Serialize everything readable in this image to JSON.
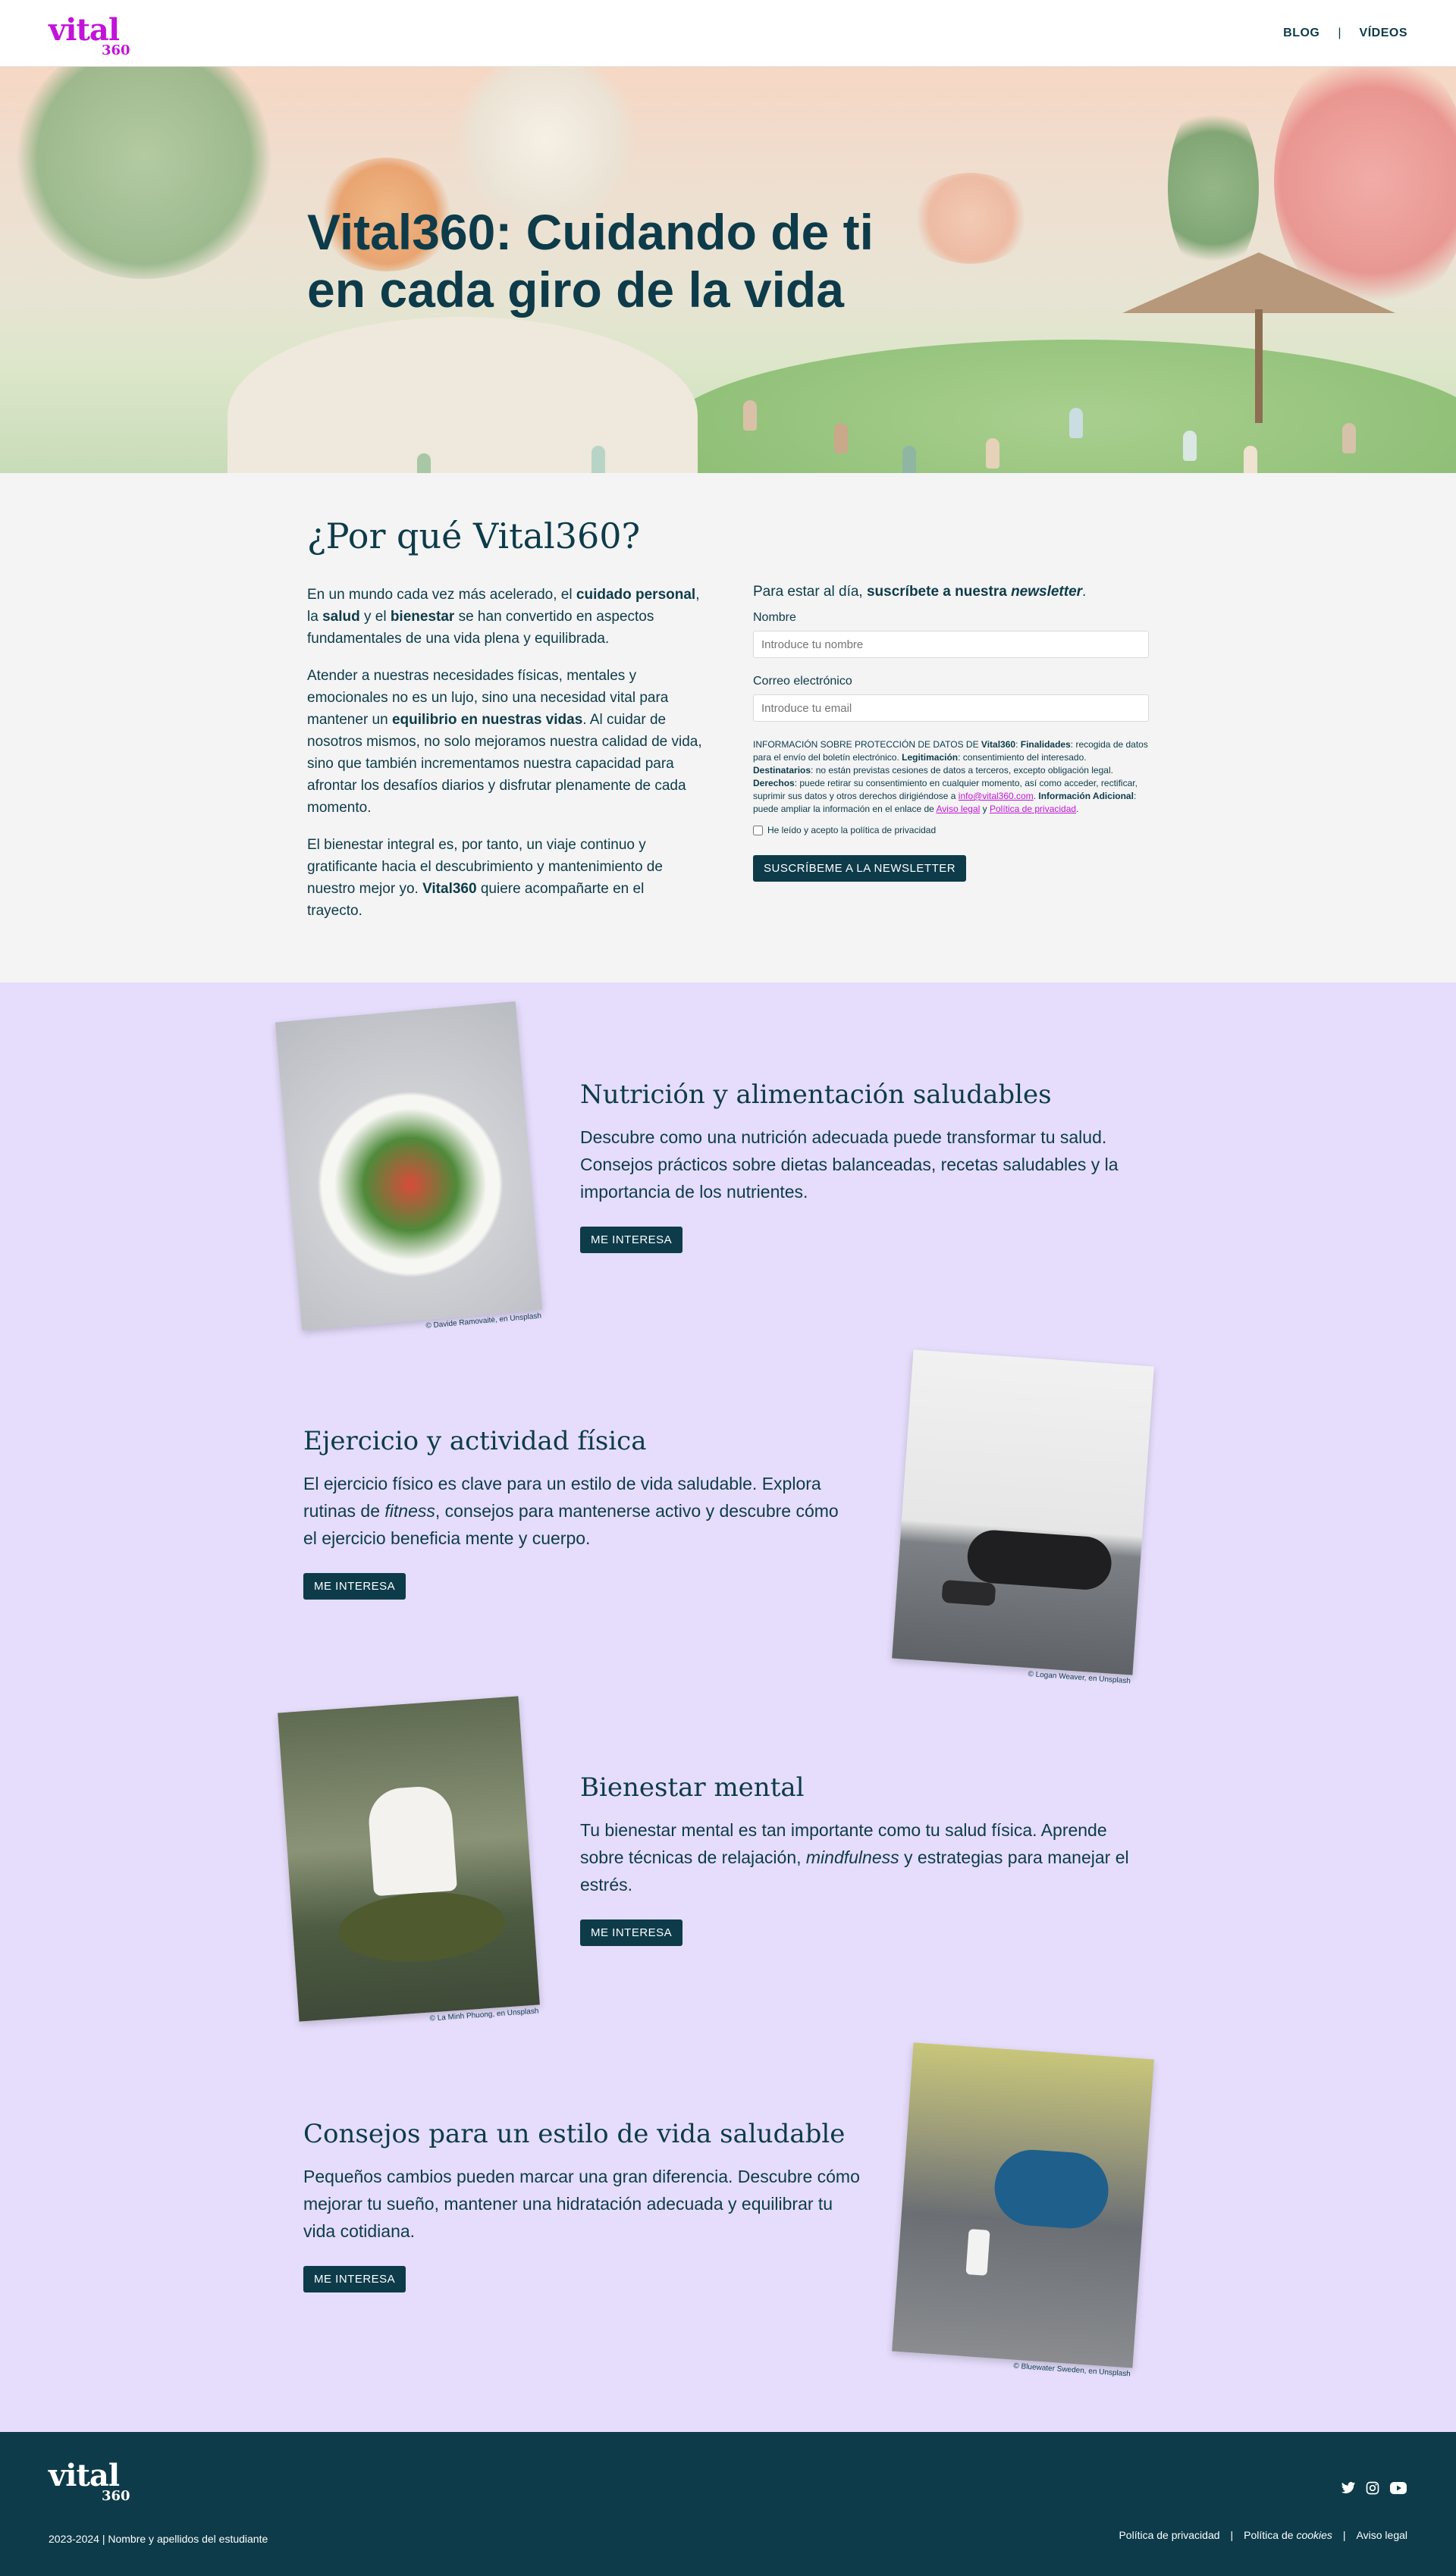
{
  "colors": {
    "primary": "#0d3b4a",
    "accent": "#c213d9",
    "why_bg": "#f4f4f4",
    "topics_bg": "#e5ddfb"
  },
  "header": {
    "logo_word": "vital",
    "logo_num": "360",
    "nav": {
      "blog": "BLOG",
      "separator": "|",
      "videos": "VÍDEOS"
    }
  },
  "hero": {
    "title": "Vital360: Cuidando de ti en cada giro de la vida"
  },
  "why": {
    "title": "¿Por qué Vital360?",
    "p1": {
      "a": "En un mundo cada vez más acelerado, el ",
      "b": "cuidado personal",
      "c": ", la ",
      "d": "salud",
      "e": " y el ",
      "f": "bienestar",
      "g": " se han convertido en aspectos fundamentales de una vida plena y equilibrada."
    },
    "p2": {
      "a": "Atender a nuestras necesidades físicas, mentales y emocionales no es un lujo, sino una necesidad vital para mantener un ",
      "b": "equilibrio en nuestras vidas",
      "c": ". Al cuidar de nosotros mismos, no solo mejoramos nuestra calidad de vida, sino que también incrementamos nuestra capacidad para afrontar los desafíos diarios y disfrutar plenamente de cada momento."
    },
    "p3": {
      "a": "El bienestar integral es, por tanto, un viaje continuo y gratificante hacia el descubrimiento y mantenimiento de nuestro mejor yo. ",
      "b": "Vital360",
      "c": " quiere acompañarte en el trayecto."
    }
  },
  "newsletter": {
    "intro_a": "Para estar al día, ",
    "intro_b": "suscríbete a nuestra ",
    "intro_c": "newsletter",
    "intro_d": ".",
    "name_label": "Nombre",
    "name_placeholder": "Introduce tu nombre",
    "email_label": "Correo electrónico",
    "email_placeholder": "Introduce tu email",
    "legal": {
      "t1": "INFORMACIÓN SOBRE PROTECCIÓN DE DATOS DE ",
      "b1": "Vital360",
      "t2": ": ",
      "b2": "Finalidades",
      "t3": ": recogida de datos para el envío del boletín electrónico. ",
      "b3": "Legitimación",
      "t4": ": consentimiento del interesado. ",
      "b4": "Destinatarios",
      "t5": ": no están previstas cesiones de datos a terceros, excepto obligación legal. ",
      "b5": "Derechos",
      "t6": ": puede retirar su consentimiento en cualquier momento, así como acceder, rectificar, suprimir sus datos y otros derechos dirigiéndose a ",
      "email": "info@vital360.com",
      "t7": ". ",
      "b6": "Información Adicional",
      "t8": ": puede ampliar la información en el enlace de ",
      "link1": "Aviso legal",
      "t9": " y ",
      "link2": "Política de privacidad",
      "t10": "."
    },
    "checkbox_label": "He leído y acepto la política de privacidad",
    "submit": "SUSCRÍBEME A LA NEWSLETTER"
  },
  "topics": [
    {
      "title": "Nutrición y alimentación saludables",
      "text": "Descubre como una nutrición adecuada puede transformar tu salud. Consejos prácticos sobre dietas balanceadas, recetas saludables y la importancia de los nutrientes.",
      "button": "ME INTERESA",
      "credit": "© Davide Ramovaitė, en Unsplash"
    },
    {
      "title": "Ejercicio y actividad física",
      "text_a": "El ejercicio físico es clave para un estilo de vida saludable. Explora rutinas de ",
      "text_em": "fitness",
      "text_b": ", consejos para mantenerse activo y descubre cómo el ejercicio beneficia mente y cuerpo.",
      "button": "ME INTERESA",
      "credit": "© Logan Weaver, en Unsplash"
    },
    {
      "title": "Bienestar mental",
      "text_a": "Tu bienestar mental es tan importante como tu salud física. Aprende sobre técnicas de relajación, ",
      "text_em": "mindfulness",
      "text_b": " y estrategias para manejar el estrés.",
      "button": "ME INTERESA",
      "credit": "© La Minh Phuong, en Unsplash"
    },
    {
      "title": "Consejos para un estilo de vida saludable",
      "text": "Pequeños cambios pueden marcar una gran diferencia. Descubre cómo mejorar tu sueño, mantener una hidratación adecuada y equilibrar tu vida cotidiana.",
      "button": "ME INTERESA",
      "credit": "© Bluewater Sweden, en Unsplash"
    }
  ],
  "footer": {
    "logo_word": "vital",
    "logo_num": "360",
    "copyright": "2023-2024 | Nombre y apellidos del estudiante",
    "social": [
      "twitter-icon",
      "instagram-icon",
      "youtube-icon"
    ],
    "links": {
      "privacy": "Política de privacidad",
      "sep": "|",
      "cookies_a": "Política de ",
      "cookies_em": "cookies",
      "legal": "Aviso legal"
    }
  }
}
